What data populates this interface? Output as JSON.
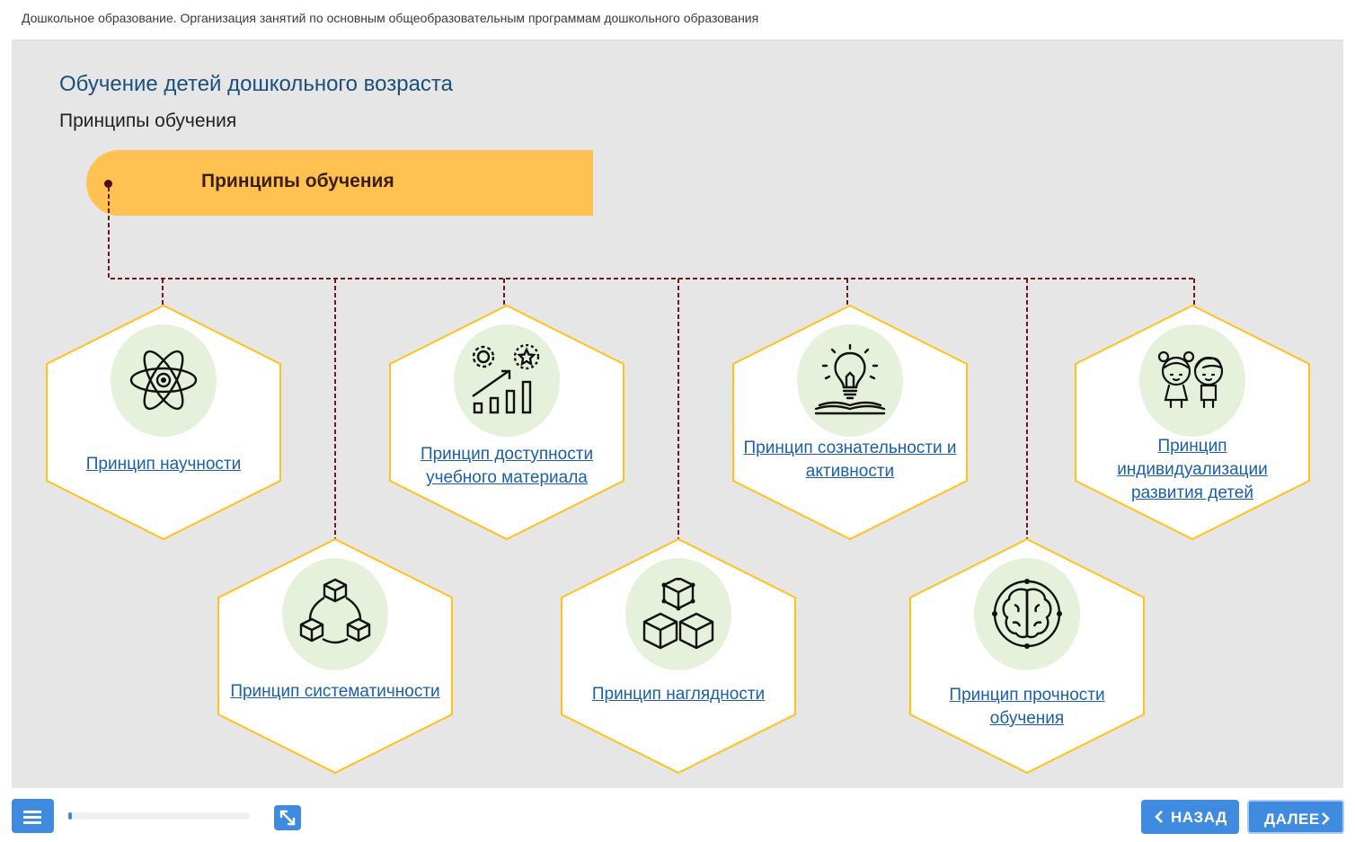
{
  "header": {
    "breadcrumb": "Дошкольное образование. Организация занятий по основным общеобразовательным программам дошкольного образования"
  },
  "slide": {
    "title": "Обучение детей дошкольного возраста",
    "subtitle": "Принципы обучения",
    "root_label": "Принципы обучения",
    "items": [
      {
        "label": "Принцип научности",
        "icon": "atom-icon"
      },
      {
        "label": "Принцип систематичности",
        "icon": "cubes-network-icon"
      },
      {
        "label": "Принцип доступности учебного материала",
        "icon": "growth-chart-icon"
      },
      {
        "label": "Принцип наглядности",
        "icon": "cubes-structure-icon"
      },
      {
        "label": "Принцип сознательности и активности",
        "icon": "lightbulb-book-icon"
      },
      {
        "label": "Принцип прочности обучения",
        "icon": "brain-icon"
      },
      {
        "label": "Принцип индивидуализации развития детей",
        "icon": "children-icon"
      }
    ]
  },
  "colors": {
    "accent": "#3f8be0",
    "pill": "#ffc152",
    "hex_border": "#ffc21a",
    "connector": "#6b1a1a",
    "link": "#1a5fa8"
  },
  "footer": {
    "progress_fraction": 0.02,
    "back_label": "НАЗАД",
    "next_label": "ДАЛЕЕ"
  }
}
